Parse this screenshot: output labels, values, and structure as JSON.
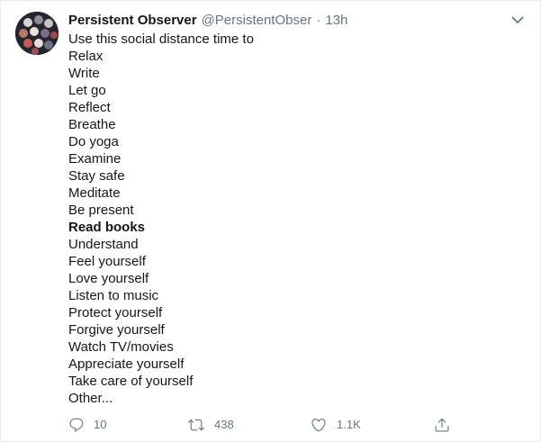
{
  "tweet": {
    "author": {
      "display_name": "Persistent Observer",
      "handle": "@PersistentObser",
      "separator": "·",
      "time": "13h"
    },
    "lines": [
      {
        "text": "Use this social distance time to",
        "bold": false
      },
      {
        "text": "Relax",
        "bold": false
      },
      {
        "text": "Write",
        "bold": false
      },
      {
        "text": "Let go",
        "bold": false
      },
      {
        "text": "Reflect",
        "bold": false
      },
      {
        "text": "Breathe",
        "bold": false
      },
      {
        "text": "Do yoga",
        "bold": false
      },
      {
        "text": "Examine",
        "bold": false
      },
      {
        "text": "Stay safe",
        "bold": false
      },
      {
        "text": "Meditate",
        "bold": false
      },
      {
        "text": "Be present",
        "bold": false
      },
      {
        "text": "Read books",
        "bold": true
      },
      {
        "text": "Understand",
        "bold": false
      },
      {
        "text": "Feel yourself",
        "bold": false
      },
      {
        "text": "Love yourself",
        "bold": false
      },
      {
        "text": "Listen to music",
        "bold": false
      },
      {
        "text": "Protect yourself",
        "bold": false
      },
      {
        "text": "Forgive yourself",
        "bold": false
      },
      {
        "text": "Watch TV/movies",
        "bold": false
      },
      {
        "text": "Appreciate yourself",
        "bold": false
      },
      {
        "text": "Take care of yourself",
        "bold": false
      },
      {
        "text": "Other...",
        "bold": false
      }
    ],
    "actions": {
      "reply": {
        "icon": "reply-icon",
        "count": "10"
      },
      "retweet": {
        "icon": "retweet-icon",
        "count": "438"
      },
      "like": {
        "icon": "heart-icon",
        "count": "1.1K"
      },
      "share": {
        "icon": "share-icon"
      }
    },
    "menu_icon": "chevron-down-icon"
  },
  "colors": {
    "text": "#14171a",
    "secondary": "#657786",
    "border": "#e6ecf0",
    "background": "#ffffff"
  }
}
